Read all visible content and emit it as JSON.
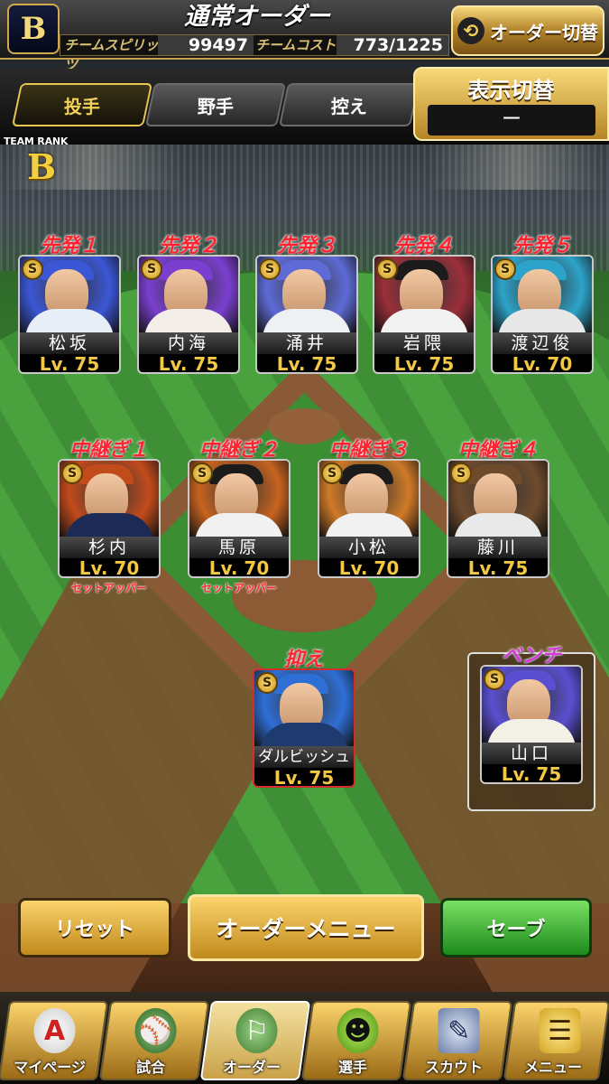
{
  "header": {
    "logo_letter": "B",
    "title": "通常オーダー",
    "spirit_label": "チームスピリッツ",
    "spirit_value": "99497",
    "cost_label": "チームコスト",
    "cost_value": "773/1225",
    "switch_order_label": "オーダー切替",
    "switch_order_icon": "rotate-arrows-icon"
  },
  "tabs": [
    {
      "label": "投手",
      "active": true
    },
    {
      "label": "野手",
      "active": false
    },
    {
      "label": "控え",
      "active": false
    }
  ],
  "display_toggle": {
    "label": "表示切替",
    "value": "ー"
  },
  "team_rank": {
    "label": "TEAM RANK",
    "rank": "B"
  },
  "starters": [
    {
      "slot": "先発１",
      "name": "松坂",
      "level": "Lv. 75",
      "rarity": "S",
      "accent": "#3b57d6",
      "uniform": "#e8eef8"
    },
    {
      "slot": "先発２",
      "name": "内海",
      "level": "Lv. 75",
      "rarity": "S",
      "accent": "#7b3fd0",
      "uniform": "#f3efe8"
    },
    {
      "slot": "先発３",
      "name": "涌井",
      "level": "Lv. 75",
      "rarity": "S",
      "accent": "#5e6bd6",
      "uniform": "#eef0f2"
    },
    {
      "slot": "先発４",
      "name": "岩隈",
      "level": "Lv. 75",
      "rarity": "S",
      "accent": "#9b2f3a",
      "uniform": "#f2f2f2"
    },
    {
      "slot": "先発５",
      "name": "渡辺俊",
      "level": "Lv. 70",
      "rarity": "S",
      "accent": "#2da3c9",
      "uniform": "#e8e8e8"
    }
  ],
  "relievers": [
    {
      "slot": "中継ぎ１",
      "name": "杉内",
      "level": "Lv. 70",
      "rarity": "S",
      "accent": "#c24b1c",
      "uniform": "#1c2a55",
      "role": "セットアッパー"
    },
    {
      "slot": "中継ぎ２",
      "name": "馬原",
      "level": "Lv. 70",
      "rarity": "S",
      "accent": "#c7631f",
      "uniform": "#f1f1f1",
      "role": "セットアッパー"
    },
    {
      "slot": "中継ぎ３",
      "name": "小松",
      "level": "Lv. 70",
      "rarity": "S",
      "accent": "#d07a27",
      "uniform": "#f1f1f1",
      "role": ""
    },
    {
      "slot": "中継ぎ４",
      "name": "藤川",
      "level": "Lv. 75",
      "rarity": "S",
      "accent": "#6e4b2d",
      "uniform": "#e9e9e9",
      "role": ""
    }
  ],
  "closer": {
    "slot": "抑え",
    "name": "ダルビッシュ",
    "level": "Lv. 75",
    "rarity": "S",
    "accent": "#2e6fd6",
    "uniform": "#1f3a6e"
  },
  "bench": {
    "slot": "ベンチ",
    "name": "山口",
    "level": "Lv. 75",
    "rarity": "S",
    "accent": "#5b4fd1",
    "uniform": "#f3f0e6"
  },
  "actions": {
    "reset": "リセット",
    "order_menu": "オーダーメニュー",
    "save": "セーブ"
  },
  "nav": [
    {
      "label": "マイページ",
      "icon": "letter-a-icon",
      "glyph": "A",
      "active": false
    },
    {
      "label": "試合",
      "icon": "stadium-icon",
      "glyph": "⚾",
      "active": false
    },
    {
      "label": "オーダー",
      "icon": "field-players-icon",
      "glyph": "⚐",
      "active": true
    },
    {
      "label": "選手",
      "icon": "player-icon",
      "glyph": "☻",
      "active": false
    },
    {
      "label": "スカウト",
      "icon": "scout-card-icon",
      "glyph": "✎",
      "active": false
    },
    {
      "label": "メニュー",
      "icon": "menu-character-icon",
      "glyph": "☰",
      "active": false
    }
  ]
}
